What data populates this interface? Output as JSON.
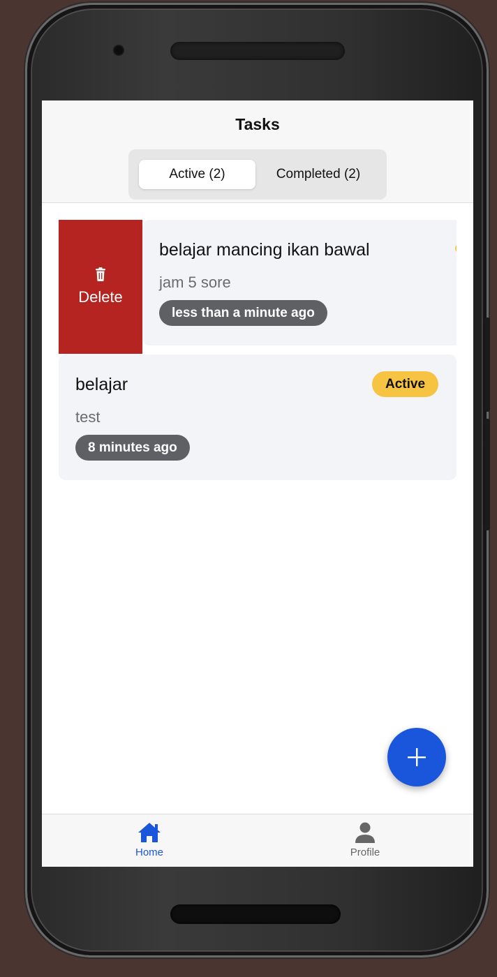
{
  "header": {
    "title": "Tasks",
    "tabs": [
      {
        "label": "Active (2)",
        "selected": true
      },
      {
        "label": "Completed (2)",
        "selected": false
      }
    ]
  },
  "tasks": [
    {
      "title": "belajar mancing ikan bawal",
      "description": "jam 5 sore",
      "time": "less than a minute ago",
      "swipe_action": "Delete"
    },
    {
      "title": "belajar",
      "description": "test",
      "time": "8 minutes ago",
      "status": "Active"
    }
  ],
  "fab": {
    "icon": "plus-icon"
  },
  "bottom_nav": {
    "items": [
      {
        "label": "Home",
        "icon": "home-icon",
        "active": true
      },
      {
        "label": "Profile",
        "icon": "person-icon",
        "active": false
      }
    ]
  },
  "colors": {
    "accent": "#1a56db",
    "delete": "#b52420",
    "status_active": "#f6c343",
    "time_badge": "#5f6064"
  }
}
